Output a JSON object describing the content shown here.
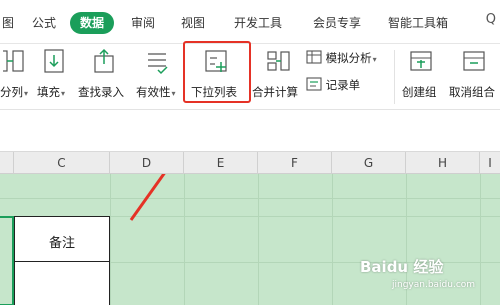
{
  "tabs": [
    {
      "label": "图",
      "active": false
    },
    {
      "label": "公式",
      "active": false
    },
    {
      "label": "数据",
      "active": true
    },
    {
      "label": "审阅",
      "active": false
    },
    {
      "label": "视图",
      "active": false
    },
    {
      "label": "开发工具",
      "active": false
    },
    {
      "label": "会员专享",
      "active": false
    },
    {
      "label": "智能工具箱",
      "active": false
    }
  ],
  "ribbon": {
    "fen_lie": "分列",
    "tian_chong": "填充",
    "cha_zhao": "查找录入",
    "you_xiao_xing": "有效性",
    "xia_la": "下拉列表",
    "he_bing": "合并计算",
    "mo_ni": "模拟分析",
    "ji_lu": "记录单",
    "chuang_jian_zu": "创建组",
    "qu_xiao_zu": "取消组合"
  },
  "columns": [
    "C",
    "D",
    "E",
    "F",
    "G",
    "H",
    "I"
  ],
  "cell": {
    "text": "备注"
  },
  "watermark": {
    "text": "Baidu 经验",
    "sub": "jingyan.baidu.com"
  },
  "colors": {
    "accent": "#1b9e5a",
    "highlight": "#e53226",
    "grid_bg": "#c6e6cb"
  }
}
